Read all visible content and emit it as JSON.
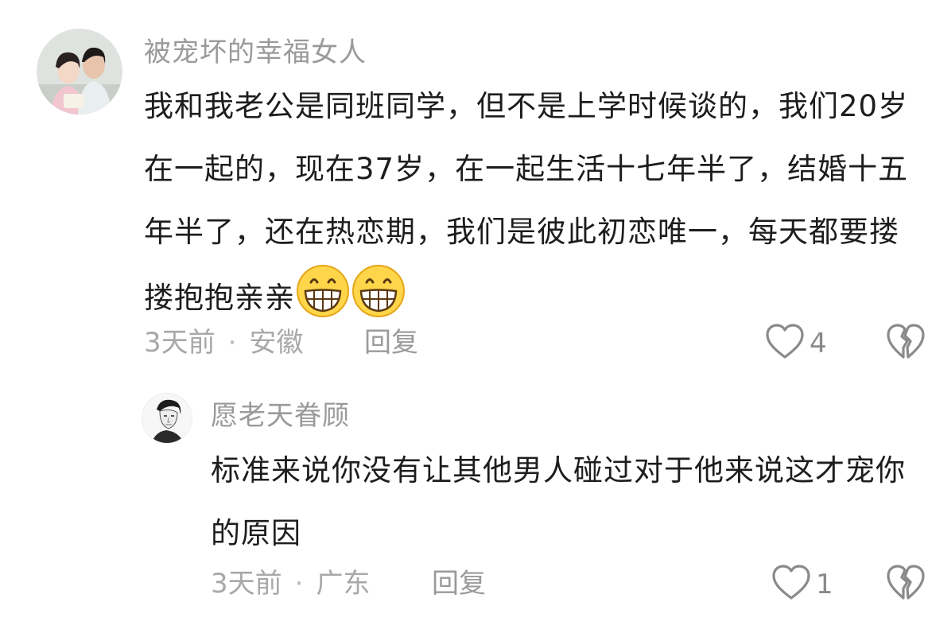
{
  "comments": [
    {
      "username": "被宠坏的幸福女人",
      "text": "我和我老公是同班同学，但不是上学时候谈的，我们20岁在一起的，现在37岁，在一起生活十七年半了，结婚十五年半了，还在热恋期，我们是彼此初恋唯一，每天都要搂搂抱抱亲亲",
      "emojis": [
        "grinning-face-icon",
        "grinning-face-icon"
      ],
      "time": "3天前",
      "location": "安徽",
      "reply_label": "回复",
      "likes": "4"
    },
    {
      "username": "愿老天眷顾",
      "text": "标准来说你没有让其他男人碰过对于他来说这才宠你的原因",
      "time": "3天前",
      "location": "广东",
      "reply_label": "回复",
      "likes": "1"
    }
  ],
  "separator": "·",
  "colors": {
    "username": "#9a9a9a",
    "text": "#1d1d1d",
    "meta": "#a8a8a8",
    "icon": "#8a8a8a"
  }
}
